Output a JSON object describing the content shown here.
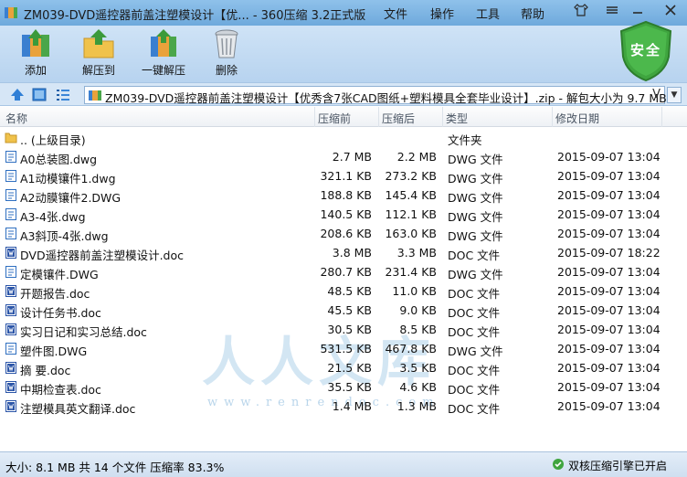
{
  "title": "ZM039-DVD遥控器前盖注塑模设计【优... - 360压缩 3.2正式版",
  "menu": [
    "文件",
    "操作",
    "工具",
    "帮助"
  ],
  "toolbar": {
    "add": "添加",
    "extract": "解压到",
    "oneclick": "一键解压",
    "delete": "删除",
    "safe": "安全"
  },
  "address": {
    "path": "ZM039-DVD遥控器前盖注塑模设计【优秀含7张CAD图纸+塑料模具全套毕业设计】.zip - 解包大小为 9.7 MB"
  },
  "columns": {
    "name": "名称",
    "size": "压缩前",
    "packed": "压缩后",
    "type": "类型",
    "date": "修改日期"
  },
  "files": [
    {
      "name": ".. (上级目录)",
      "size": "",
      "packed": "",
      "type": "文件夹",
      "date": "",
      "icon": "folder"
    },
    {
      "name": "A0总装图.dwg",
      "size": "2.7 MB",
      "packed": "2.2 MB",
      "type": "DWG 文件",
      "date": "2015-09-07 13:04",
      "icon": "dwg"
    },
    {
      "name": "A1动模镶件1.dwg",
      "size": "321.1 KB",
      "packed": "273.2 KB",
      "type": "DWG 文件",
      "date": "2015-09-07 13:04",
      "icon": "dwg"
    },
    {
      "name": "A2动膜镶件2.DWG",
      "size": "188.8 KB",
      "packed": "145.4 KB",
      "type": "DWG 文件",
      "date": "2015-09-07 13:04",
      "icon": "dwg"
    },
    {
      "name": "A3-4张.dwg",
      "size": "140.5 KB",
      "packed": "112.1 KB",
      "type": "DWG 文件",
      "date": "2015-09-07 13:04",
      "icon": "dwg"
    },
    {
      "name": "A3斜顶-4张.dwg",
      "size": "208.6 KB",
      "packed": "163.0 KB",
      "type": "DWG 文件",
      "date": "2015-09-07 13:04",
      "icon": "dwg"
    },
    {
      "name": "DVD遥控器前盖注塑模设计.doc",
      "size": "3.8 MB",
      "packed": "3.3 MB",
      "type": "DOC 文件",
      "date": "2015-09-07 18:22",
      "icon": "doc"
    },
    {
      "name": "定模镶件.DWG",
      "size": "280.7 KB",
      "packed": "231.4 KB",
      "type": "DWG 文件",
      "date": "2015-09-07 13:04",
      "icon": "dwg"
    },
    {
      "name": "开题报告.doc",
      "size": "48.5 KB",
      "packed": "11.0 KB",
      "type": "DOC 文件",
      "date": "2015-09-07 13:04",
      "icon": "doc"
    },
    {
      "name": "设计任务书.doc",
      "size": "45.5 KB",
      "packed": "9.0 KB",
      "type": "DOC 文件",
      "date": "2015-09-07 13:04",
      "icon": "doc"
    },
    {
      "name": "实习日记和实习总结.doc",
      "size": "30.5 KB",
      "packed": "8.5 KB",
      "type": "DOC 文件",
      "date": "2015-09-07 13:04",
      "icon": "doc"
    },
    {
      "name": "塑件图.DWG",
      "size": "531.5 KB",
      "packed": "467.8 KB",
      "type": "DWG 文件",
      "date": "2015-09-07 13:04",
      "icon": "dwg"
    },
    {
      "name": "摘  要.doc",
      "size": "21.5 KB",
      "packed": "3.5 KB",
      "type": "DOC 文件",
      "date": "2015-09-07 13:04",
      "icon": "doc"
    },
    {
      "name": "中期检查表.doc",
      "size": "35.5 KB",
      "packed": "4.6 KB",
      "type": "DOC 文件",
      "date": "2015-09-07 13:04",
      "icon": "doc"
    },
    {
      "name": "注塑模具英文翻译.doc",
      "size": "1.4 MB",
      "packed": "1.3 MB",
      "type": "DOC 文件",
      "date": "2015-09-07 13:04",
      "icon": "doc"
    }
  ],
  "watermark": {
    "main": "人人文库",
    "sub": "www.renrendoc.com"
  },
  "status": {
    "left": "大小: 8.1 MB 共 14 个文件 压缩率 83.3%",
    "right": "双核压缩引擎已开启"
  },
  "colors": {
    "titlebar": "#7ab3e2",
    "toolbar": "#c4dbf2",
    "safe_badge": "#3fa53f",
    "dwg_icon": "#2f6fc0",
    "doc_icon": "#2b55a8"
  }
}
